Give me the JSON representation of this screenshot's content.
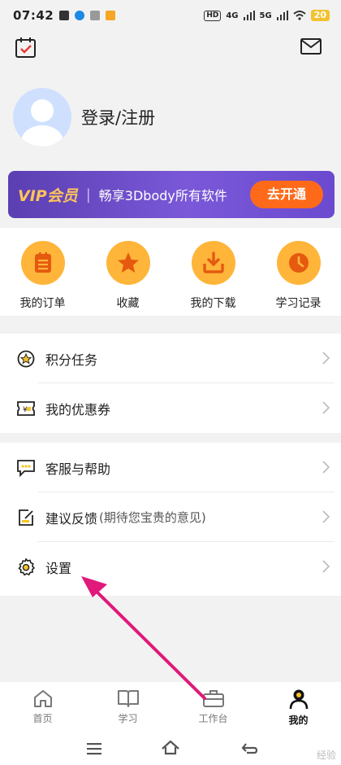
{
  "status_bar": {
    "time": "07:42",
    "hd_label": "HD",
    "net1": "4G",
    "net2": "5G",
    "battery": "20"
  },
  "header": {
    "calendar_icon": "calendar-check-icon",
    "mail_icon": "mail-icon"
  },
  "profile": {
    "login_text": "登录/注册"
  },
  "vip": {
    "title": "VIP会员",
    "separator": "|",
    "desc": "畅享3Dbody所有软件",
    "button": "去开通",
    "colors": {
      "banner": "#6b4ad0",
      "button": "#ff6a1a",
      "title": "#ffc45c"
    }
  },
  "quick_actions": [
    {
      "label": "我的订单",
      "icon": "order-list-icon"
    },
    {
      "label": "收藏",
      "icon": "star-icon"
    },
    {
      "label": "我的下载",
      "icon": "download-icon"
    },
    {
      "label": "学习记录",
      "icon": "clock-icon"
    }
  ],
  "menu_section_1": [
    {
      "label": "积分任务",
      "icon": "points-star-icon"
    },
    {
      "label": "我的优惠券",
      "icon": "coupon-icon"
    }
  ],
  "menu_section_2": [
    {
      "label": "客服与帮助",
      "icon": "chat-help-icon"
    },
    {
      "label": "建议反馈",
      "sub": "(期待您宝贵的意见)",
      "icon": "feedback-icon"
    },
    {
      "label": "设置",
      "icon": "gear-icon"
    }
  ],
  "bottom_nav": [
    {
      "label": "首页",
      "icon": "home-icon",
      "active": false
    },
    {
      "label": "学习",
      "icon": "book-icon",
      "active": false
    },
    {
      "label": "工作台",
      "icon": "briefcase-icon",
      "active": false
    },
    {
      "label": "我的",
      "icon": "user-icon",
      "active": true
    }
  ],
  "watermark": "经验",
  "accent_color": "#ffb53a",
  "annotation_arrow_color": "#e0197a"
}
